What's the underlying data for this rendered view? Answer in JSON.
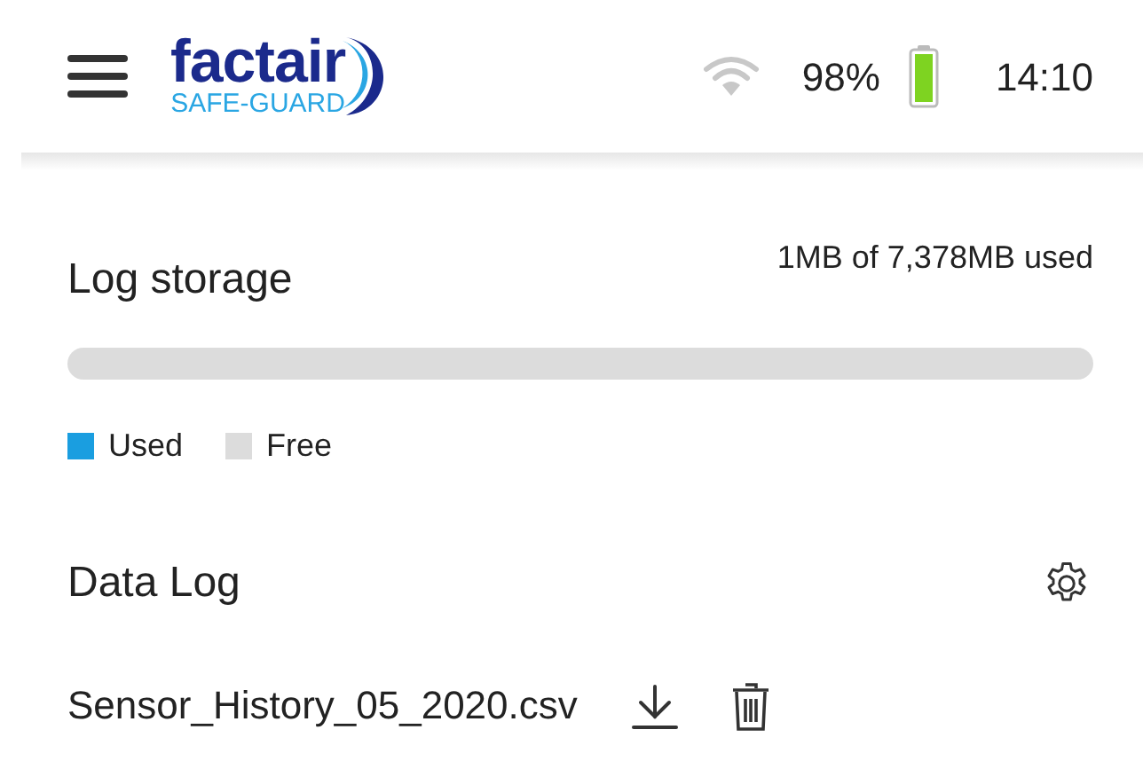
{
  "header": {
    "logo": {
      "name": "factair",
      "tagline": "SAFE-GUARD"
    },
    "battery": "98%",
    "time": "14:10"
  },
  "log_storage": {
    "title": "Log storage",
    "usage": "1MB of 7,378MB used",
    "level": 0,
    "legend": [
      {
        "label": "Used",
        "color": "#1a9ee0"
      },
      {
        "label": "Free",
        "color": "#dcdcdc"
      }
    ]
  },
  "data_log": {
    "title": "Data Log",
    "files": [
      {
        "name": "Sensor_History_05_2020.csv"
      }
    ]
  }
}
